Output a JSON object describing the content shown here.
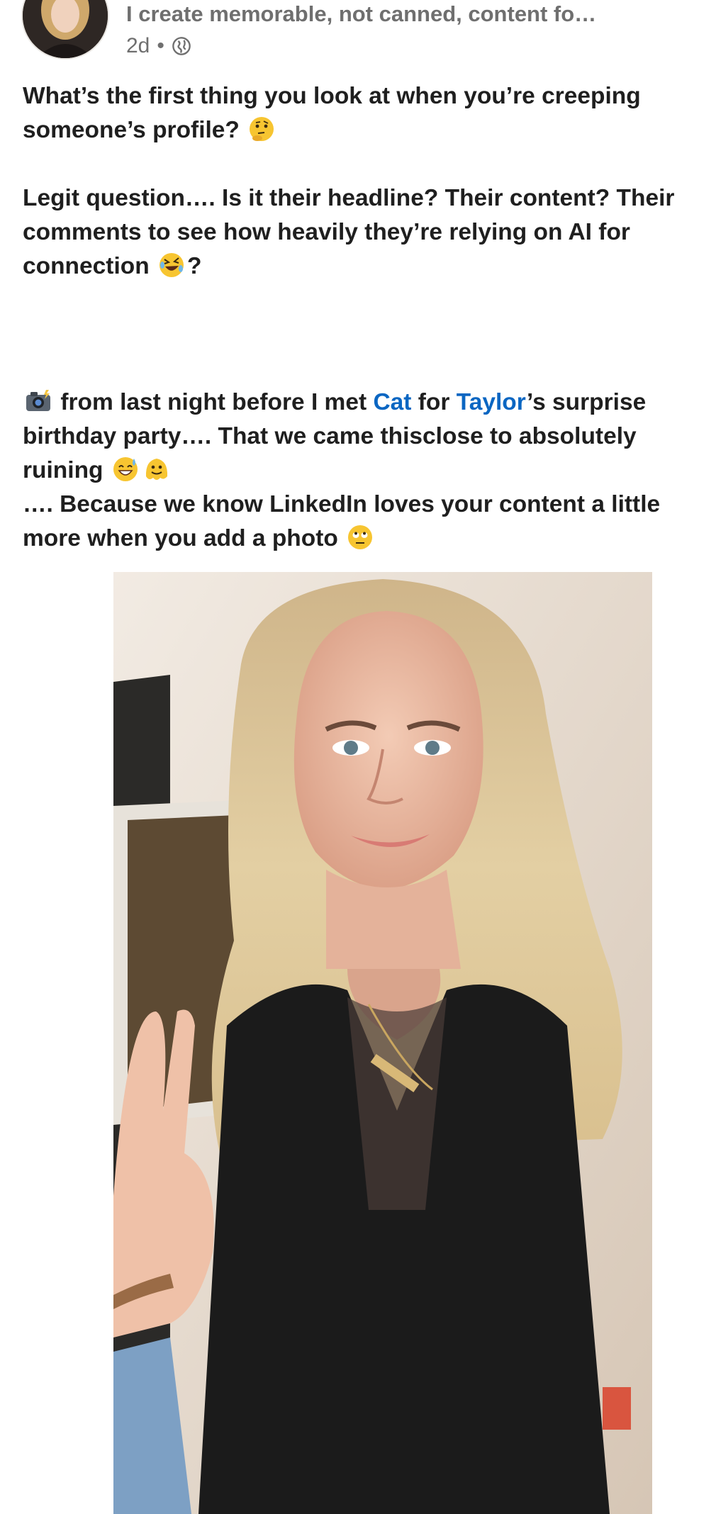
{
  "header": {
    "headline": "I create memorable, not canned, content fo…",
    "time": "2d",
    "separator": "•",
    "visibility_icon": "globe-icon"
  },
  "post": {
    "line1": "What’s the first thing you look at when you’re creeping someone’s profile?",
    "line1_emoji": "thinking-face-icon",
    "line2": "Legit question…. Is it their headline? Their content? Their comments to see how heavily they’re relying on AI for connection",
    "line2_emoji": "rolling-laughing-icon",
    "line2_end": "?",
    "line3_part1": "from last night before I met",
    "mention_1": "Cat",
    "line3_part2": "for",
    "mention_2": "Taylor",
    "line3_part3": "’s surprise birthday party…. That we came thisclose to absolutely ruining",
    "line4": "…. Because we know LinkedIn loves your content a little more when you add a photo",
    "line3_emoji_start": "camera-flash-icon",
    "line3_emoji_end_1": "sweat-smile-icon",
    "line3_emoji_end_2": "melting-face-icon",
    "line4_emoji": "eye-roll-icon"
  },
  "colors": {
    "text": "#1f1f1f",
    "meta": "#6f6f6f",
    "mention": "#0a66c2"
  }
}
